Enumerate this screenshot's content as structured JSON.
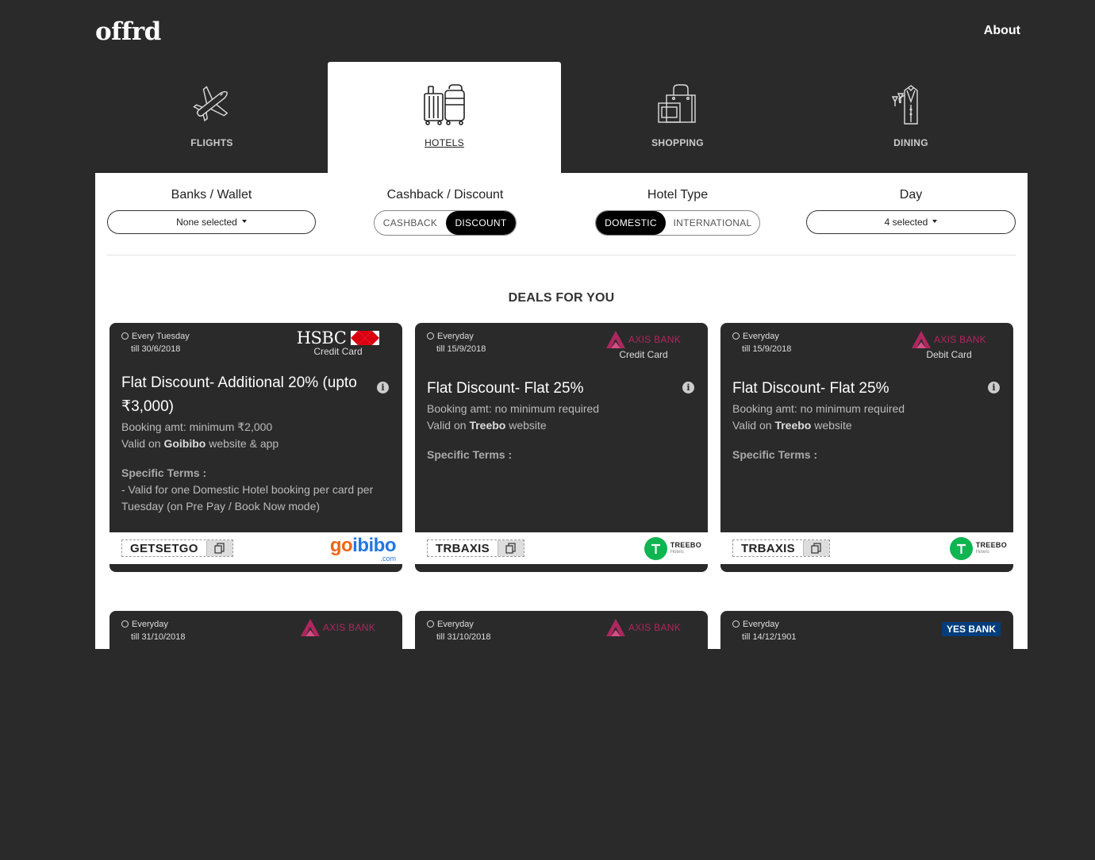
{
  "header": {
    "logo": "offrd",
    "about": "About"
  },
  "tabs": [
    {
      "label": "FLIGHTS",
      "icon": "airplane-icon",
      "active": false
    },
    {
      "label": "HOTELS",
      "icon": "luggage-icon",
      "active": true
    },
    {
      "label": "SHOPPING",
      "icon": "shopping-bag-icon",
      "active": false
    },
    {
      "label": "DINING",
      "icon": "waiter-icon",
      "active": false
    }
  ],
  "filters": {
    "banks": {
      "title": "Banks / Wallet",
      "value": "None selected"
    },
    "cashback": {
      "title": "Cashback / Discount",
      "options": [
        "CASHBACK",
        "DISCOUNT"
      ],
      "selected": "DISCOUNT"
    },
    "hotel_type": {
      "title": "Hotel Type",
      "options": [
        "DOMESTIC",
        "INTERNATIONAL"
      ],
      "selected": "DOMESTIC"
    },
    "day": {
      "title": "Day",
      "value": "4 selected"
    }
  },
  "deals_title": "DEALS FOR YOU",
  "colors": {
    "axis": "#ae275f",
    "hsbc_red": "#db0011",
    "goibibo_orange": "#ef6614",
    "goibibo_blue": "#2276e3",
    "treebo_green": "#0eb550",
    "yes_blue": "#003d7c",
    "yes_red": "#e31837"
  },
  "deals": [
    {
      "schedule": "Every Tuesday",
      "till": "till 30/6/2018",
      "bank": "HSBC",
      "card_type": "Credit Card",
      "title": "Flat Discount- Additional 20% (upto ₹3,000)",
      "booking": "Booking amt: minimum ₹2,000",
      "valid_prefix": "Valid on ",
      "valid_merchant": "Goibibo",
      "valid_suffix": " website & app",
      "terms_heading": "Specific Terms :",
      "terms": "- Valid for one Domestic Hotel booking per card per Tuesday (on Pre Pay / Book Now mode)",
      "code": "GETSETGO",
      "merchant": "goibibo",
      "merchant_sub": ".com"
    },
    {
      "schedule": "Everyday",
      "till": "till 15/9/2018",
      "bank": "AXIS BANK",
      "card_type": "Credit Card",
      "title": "Flat Discount- Flat 25%",
      "booking": "Booking amt: no minimum required",
      "valid_prefix": "Valid on ",
      "valid_merchant": "Treebo",
      "valid_suffix": " website",
      "terms_heading": "Specific Terms :",
      "terms": "",
      "code": "TRBAXIS",
      "merchant": "TREEBO",
      "merchant_sub": "Hotels"
    },
    {
      "schedule": "Everyday",
      "till": "till 15/9/2018",
      "bank": "AXIS BANK",
      "card_type": "Debit Card",
      "title": "Flat Discount- Flat 25%",
      "booking": "Booking amt: no minimum required",
      "valid_prefix": "Valid on ",
      "valid_merchant": "Treebo",
      "valid_suffix": " website",
      "terms_heading": "Specific Terms :",
      "terms": "",
      "code": "TRBAXIS",
      "merchant": "TREEBO",
      "merchant_sub": "Hotels"
    },
    {
      "schedule": "Everyday",
      "till": "till 31/10/2018",
      "bank": "AXIS BANK"
    },
    {
      "schedule": "Everyday",
      "till": "till 31/10/2018",
      "bank": "AXIS BANK"
    },
    {
      "schedule": "Everyday",
      "till": "till 14/12/1901",
      "bank": "YES BANK"
    }
  ]
}
